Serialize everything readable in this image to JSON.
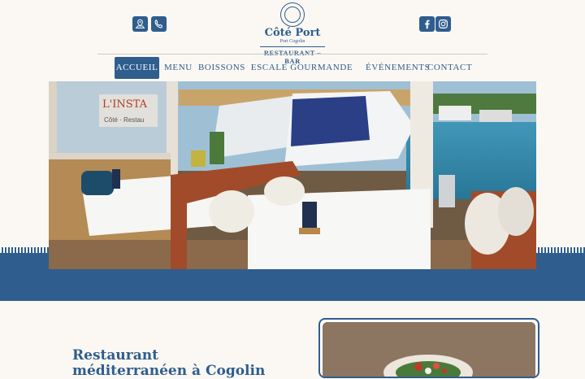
{
  "brand": {
    "name": "Côté Port",
    "location": "Port Cogolin",
    "tagline": "RESTAURANT – BAR"
  },
  "header": {
    "left_icons": [
      "map-location-icon",
      "phone-icon"
    ],
    "right_icons": [
      "facebook-icon",
      "instagram-icon"
    ]
  },
  "nav": {
    "items": [
      {
        "label": "ACCUEIL",
        "active": true
      },
      {
        "label": "MENU",
        "active": false
      },
      {
        "label": "BOISSONS",
        "active": false
      },
      {
        "label": "ESCALE GOURMANDE EN MER",
        "active": false
      },
      {
        "label": "ÉVÉNEMENTS",
        "active": false
      },
      {
        "label": "CONTACT",
        "active": false
      }
    ]
  },
  "hero": {
    "window_sign": "L'INSTA",
    "window_sign_sub": "Côté · Restau"
  },
  "intro": {
    "title": "Restaurant méditerranéen à Cogolin"
  },
  "colors": {
    "primary": "#2f5d8e",
    "background": "#fbf8f3"
  }
}
